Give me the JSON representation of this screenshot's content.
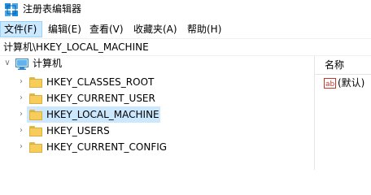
{
  "window": {
    "title": "注册表编辑器",
    "icon": "registry-editor-icon"
  },
  "menu": {
    "file": "文件(F)",
    "edit": "编辑(E)",
    "view": "查看(V)",
    "favorites": "收藏夹(A)",
    "help": "帮助(H)"
  },
  "address": {
    "path": "计算机\\HKEY_LOCAL_MACHINE"
  },
  "tree": {
    "root": {
      "label": "计算机",
      "icon": "computer-icon",
      "expanded": true
    },
    "hives": [
      {
        "label": "HKEY_CLASSES_ROOT",
        "selected": false
      },
      {
        "label": "HKEY_CURRENT_USER",
        "selected": false
      },
      {
        "label": "HKEY_LOCAL_MACHINE",
        "selected": true
      },
      {
        "label": "HKEY_USERS",
        "selected": false
      },
      {
        "label": "HKEY_CURRENT_CONFIG",
        "selected": false
      }
    ]
  },
  "values_pane": {
    "header_name": "名称",
    "rows": [
      {
        "name": "(默认)",
        "icon": "string-value-icon"
      }
    ]
  },
  "colors": {
    "selection": "#cce8ff",
    "folder": "#f6cc5a",
    "accent": "#0078d7"
  }
}
